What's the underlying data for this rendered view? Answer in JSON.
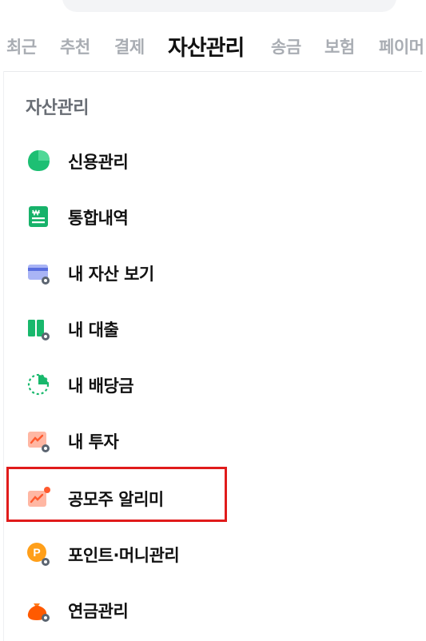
{
  "tabs": [
    {
      "label": "최근"
    },
    {
      "label": "추천"
    },
    {
      "label": "결제"
    },
    {
      "label": "자산관리",
      "active": true
    },
    {
      "label": "송금"
    },
    {
      "label": "보험"
    },
    {
      "label": "페이머"
    }
  ],
  "section_title": "자산관리",
  "items": [
    {
      "label": "신용관리",
      "icon": "credit-icon"
    },
    {
      "label": "통합내역",
      "icon": "won-receipt-icon"
    },
    {
      "label": "내 자산 보기",
      "icon": "card-gear-icon"
    },
    {
      "label": "내 대출",
      "icon": "loan-gear-icon"
    },
    {
      "label": "내 배당금",
      "icon": "dividend-pie-icon"
    },
    {
      "label": "내 투자",
      "icon": "invest-gear-icon"
    },
    {
      "label": "공모주 알리미",
      "icon": "ipo-alert-icon"
    },
    {
      "label": "포인트·머니관리",
      "icon": "point-gear-icon"
    },
    {
      "label": "연금관리",
      "icon": "pension-pouch-icon"
    }
  ],
  "colors": {
    "accent_green": "#1dbf73",
    "highlight_red": "#e01b1b",
    "muted_text": "#a9adb3"
  }
}
